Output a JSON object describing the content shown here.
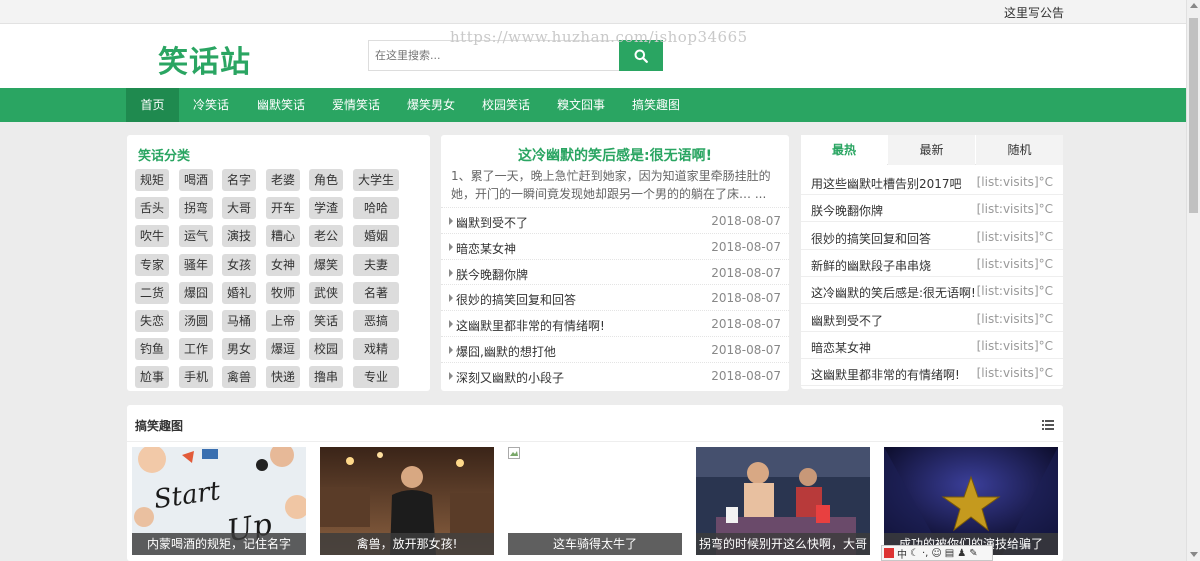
{
  "topbar": {
    "notice": "这里写公告"
  },
  "header": {
    "logo": "笑话站",
    "search_placeholder": "在这里搜索...",
    "search_icon": "search-icon"
  },
  "watermark": "https://www.huzhan.com/ishop34665",
  "nav": [
    "首页",
    "冷笑话",
    "幽默笑话",
    "爱情笑话",
    "爆笑男女",
    "校园笑话",
    "糗文囧事",
    "搞笑趣图"
  ],
  "categories": {
    "title": "笑话分类",
    "tags": [
      "规矩",
      "喝酒",
      "名字",
      "老婆",
      "角色",
      "大学生",
      "舌头",
      "拐弯",
      "大哥",
      "开车",
      "学渣",
      "哈哈",
      "吹牛",
      "运气",
      "演技",
      "糟心",
      "老公",
      "婚姻",
      "专家",
      "骚年",
      "女孩",
      "女神",
      "爆笑",
      "夫妻",
      "二货",
      "爆囧",
      "婚礼",
      "牧师",
      "武侠",
      "名著",
      "失恋",
      "汤圆",
      "马桶",
      "上帝",
      "笑话",
      "恶搞",
      "钓鱼",
      "工作",
      "男女",
      "爆逗",
      "校园",
      "戏精",
      "尬事",
      "手机",
      "禽兽",
      "快递",
      "撸串",
      "专业"
    ]
  },
  "featured": {
    "title": "这冷幽默的笑后感是:很无语啊!",
    "summary": "1、累了一天，晚上急忙赶到她家，因为知道家里牵肠挂肚的她，开门的一瞬间竟发现她却跟另一个男的的躺在了床… ...",
    "items": [
      {
        "title": "幽默到受不了",
        "date": "2018-08-07"
      },
      {
        "title": "暗恋某女神",
        "date": "2018-08-07"
      },
      {
        "title": "朕今晚翻你牌",
        "date": "2018-08-07"
      },
      {
        "title": "很妙的搞笑回复和回答",
        "date": "2018-08-07"
      },
      {
        "title": "这幽默里都非常的有情绪啊!",
        "date": "2018-08-07"
      },
      {
        "title": "爆囧,幽默的想打他",
        "date": "2018-08-07"
      },
      {
        "title": "深刻又幽默的小段子",
        "date": "2018-08-07"
      }
    ]
  },
  "ranking": {
    "tabs": [
      "最热",
      "最新",
      "随机"
    ],
    "items": [
      {
        "title": "用这些幽默吐槽告别2017吧",
        "visits": "[list:visits]°C"
      },
      {
        "title": "朕今晚翻你牌",
        "visits": "[list:visits]°C"
      },
      {
        "title": "很妙的搞笑回复和回答",
        "visits": "[list:visits]°C"
      },
      {
        "title": "新鲜的幽默段子串串烧",
        "visits": "[list:visits]°C"
      },
      {
        "title": "这冷幽默的笑后感是:很无语啊!",
        "visits": "[list:visits]°C"
      },
      {
        "title": "幽默到受不了",
        "visits": "[list:visits]°C"
      },
      {
        "title": "暗恋某女神",
        "visits": "[list:visits]°C"
      },
      {
        "title": "这幽默里都非常的有情绪啊!",
        "visits": "[list:visits]°C"
      }
    ]
  },
  "gallery": {
    "title": "搞笑趣图",
    "items": [
      {
        "caption": "内蒙喝酒的规矩，记住名字",
        "art": "Start Up"
      },
      {
        "caption": "禽兽，放开那女孩!"
      },
      {
        "caption": "这车骑得太牛了"
      },
      {
        "caption": "拐弯的时候别开这么快啊，大哥"
      },
      {
        "caption": "成功的被你们的演技给骗了"
      }
    ]
  },
  "ime": {
    "label": "中"
  },
  "colors": {
    "brand": "#2aa562",
    "brand_dark": "#1f8a4f"
  }
}
